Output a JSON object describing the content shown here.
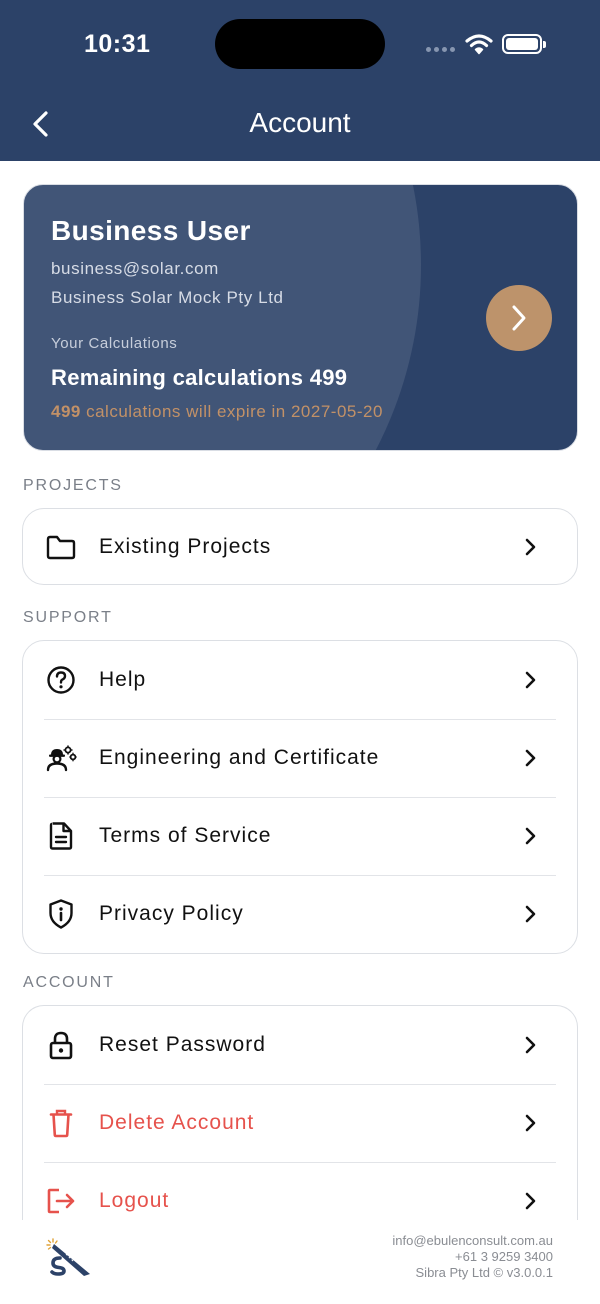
{
  "status_bar": {
    "time": "10:31"
  },
  "header": {
    "title": "Account"
  },
  "user_card": {
    "name": "Business User",
    "email": "business@solar.com",
    "company": "Business Solar Mock Pty Ltd",
    "calc_caption": "Your Calculations",
    "remaining": "Remaining calculations 499",
    "expiry_count": "499",
    "expiry_text": " calculations will expire in 2027-05-20"
  },
  "sections": {
    "projects": {
      "label": "PROJECTS",
      "items": [
        {
          "label": "Existing Projects",
          "icon": "folder-icon"
        }
      ]
    },
    "support": {
      "label": "SUPPORT",
      "items": [
        {
          "label": "Help",
          "icon": "help-circle-icon"
        },
        {
          "label": "Engineering and Certificate",
          "icon": "engineer-icon"
        },
        {
          "label": "Terms of Service",
          "icon": "document-icon"
        },
        {
          "label": "Privacy Policy",
          "icon": "shield-info-icon"
        }
      ]
    },
    "account": {
      "label": "ACCOUNT",
      "items": [
        {
          "label": "Reset Password",
          "icon": "lock-icon"
        },
        {
          "label": "Delete Account",
          "icon": "trash-icon"
        },
        {
          "label": "Logout",
          "icon": "logout-icon"
        }
      ]
    }
  },
  "footer": {
    "email": "info@ebulenconsult.com.au",
    "phone": "+61 3 9259 3400",
    "copyright": "Sibra Pty Ltd © v3.0.0.1"
  },
  "colors": {
    "brand": "#2c4268",
    "accent": "#bd936b",
    "danger": "#e6524c"
  }
}
